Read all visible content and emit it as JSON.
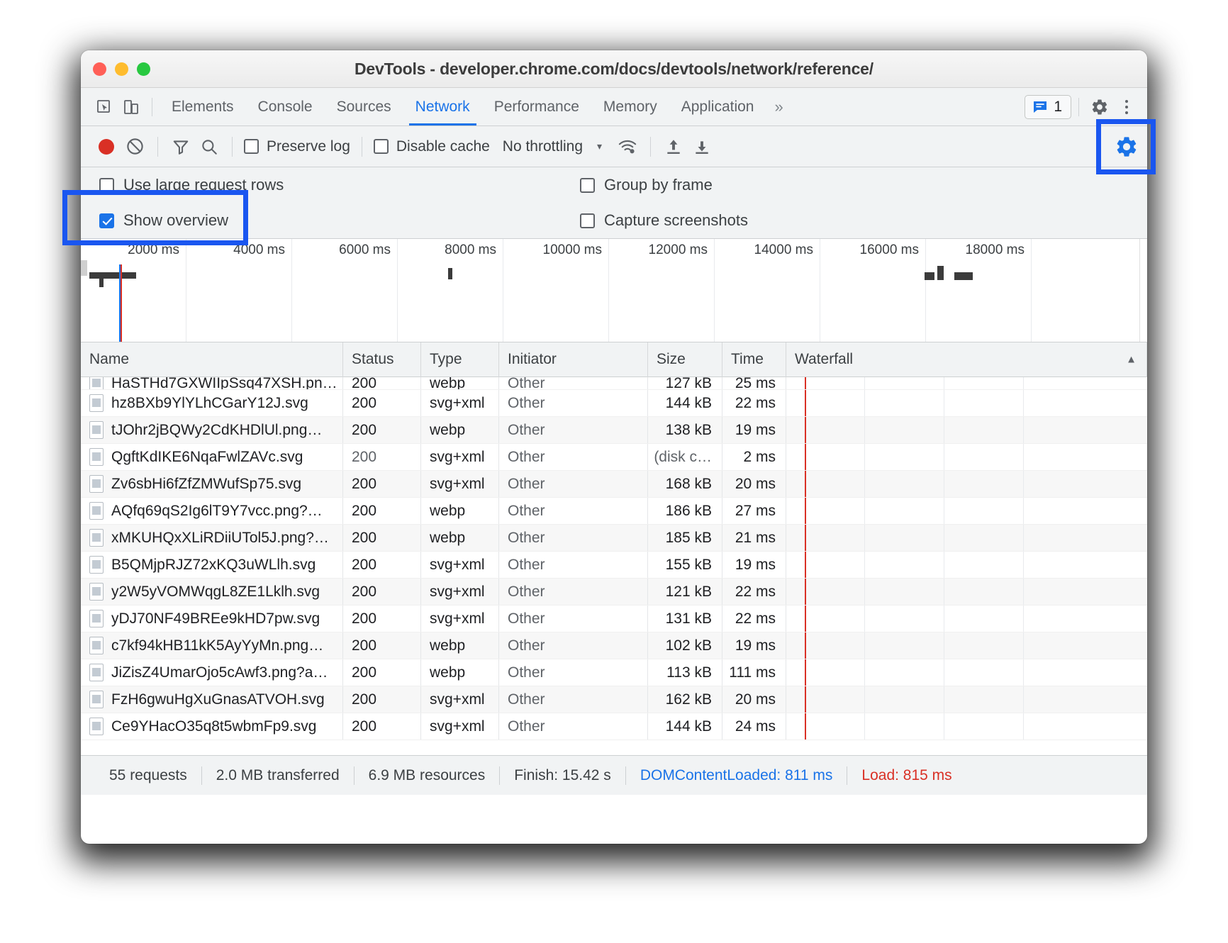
{
  "window": {
    "title": "DevTools - developer.chrome.com/docs/devtools/network/reference/",
    "traffic": {
      "close": "close-button",
      "minimize": "minimize-button",
      "zoom": "zoom-button"
    }
  },
  "tabstrip": {
    "inspect_icon": "inspect-element-icon",
    "device_icon": "device-toolbar-icon",
    "tabs": [
      {
        "label": "Elements",
        "active": false
      },
      {
        "label": "Console",
        "active": false
      },
      {
        "label": "Sources",
        "active": false
      },
      {
        "label": "Network",
        "active": true
      },
      {
        "label": "Performance",
        "active": false
      },
      {
        "label": "Memory",
        "active": false
      },
      {
        "label": "Application",
        "active": false
      }
    ],
    "more_tabs_label": "»",
    "issues_count": "1",
    "issues_icon": "issues-message-icon",
    "settings_icon": "settings-gear-icon",
    "menu_icon": "more-options-icon"
  },
  "toolbar": {
    "record_icon": "record-button-icon",
    "clear_icon": "clear-network-log-icon",
    "filter_icon": "filter-icon",
    "search_icon": "search-icon",
    "preserve_log_label": "Preserve log",
    "preserve_log_checked": false,
    "disable_cache_label": "Disable cache",
    "disable_cache_checked": false,
    "throttling_value": "No throttling",
    "throttling_caret": "▾",
    "network_conditions_icon": "network-conditions-wifi-icon",
    "import_icon": "import-har-icon",
    "export_icon": "export-har-icon",
    "settings_gear_icon": "network-settings-gear-icon"
  },
  "settings_pane": {
    "use_large_rows_label": "Use large request rows",
    "use_large_rows_checked": false,
    "group_by_frame_label": "Group by frame",
    "group_by_frame_checked": false,
    "show_overview_label": "Show overview",
    "show_overview_checked": true,
    "capture_screenshots_label": "Capture screenshots",
    "capture_screenshots_checked": false
  },
  "overview": {
    "ticks": [
      "2000 ms",
      "4000 ms",
      "6000 ms",
      "8000 ms",
      "10000 ms",
      "12000 ms",
      "14000 ms",
      "16000 ms",
      "18000 ms"
    ]
  },
  "table": {
    "columns": [
      "Name",
      "Status",
      "Type",
      "Initiator",
      "Size",
      "Time",
      "Waterfall"
    ],
    "sort_indicator": "▲",
    "clipped_row": {
      "name": "HaSTHd7GXWIIpSsq47XSH.png...",
      "status": "200",
      "type": "webp",
      "initiator": "Other",
      "size": "127 kB",
      "time": "25 ms"
    },
    "rows": [
      {
        "name": "hz8BXb9YlYLhCGarY12J.svg",
        "status": "200",
        "type": "svg+xml",
        "initiator": "Other",
        "size": "144 kB",
        "time": "22 ms"
      },
      {
        "name": "tJOhr2jBQWy2CdKHDlUl.png…",
        "status": "200",
        "type": "webp",
        "initiator": "Other",
        "size": "138 kB",
        "time": "19 ms"
      },
      {
        "name": "QgftKdIKE6NqaFwlZAVc.svg",
        "status": "200",
        "type": "svg+xml",
        "initiator": "Other",
        "size": "(disk c…",
        "time": "2 ms"
      },
      {
        "name": "Zv6sbHi6fZfZMWufSp75.svg",
        "status": "200",
        "type": "svg+xml",
        "initiator": "Other",
        "size": "168 kB",
        "time": "20 ms"
      },
      {
        "name": "AQfq69qS2Ig6lT9Y7vcc.png?…",
        "status": "200",
        "type": "webp",
        "initiator": "Other",
        "size": "186 kB",
        "time": "27 ms"
      },
      {
        "name": "xMKUHQxXLiRDiiUTol5J.png?…",
        "status": "200",
        "type": "webp",
        "initiator": "Other",
        "size": "185 kB",
        "time": "21 ms"
      },
      {
        "name": "B5QMjpRJZ72xKQ3uWLlh.svg",
        "status": "200",
        "type": "svg+xml",
        "initiator": "Other",
        "size": "155 kB",
        "time": "19 ms"
      },
      {
        "name": "y2W5yVOMWqgL8ZE1Lklh.svg",
        "status": "200",
        "type": "svg+xml",
        "initiator": "Other",
        "size": "121 kB",
        "time": "22 ms"
      },
      {
        "name": "yDJ70NF49BREe9kHD7pw.svg",
        "status": "200",
        "type": "svg+xml",
        "initiator": "Other",
        "size": "131 kB",
        "time": "22 ms"
      },
      {
        "name": "c7kf94kHB11kK5AyYyMn.png…",
        "status": "200",
        "type": "webp",
        "initiator": "Other",
        "size": "102 kB",
        "time": "19 ms"
      },
      {
        "name": "JiZisZ4UmarOjo5cAwf3.png?a…",
        "status": "200",
        "type": "webp",
        "initiator": "Other",
        "size": "113 kB",
        "time": "111 ms"
      },
      {
        "name": "FzH6gwuHgXuGnasATVOH.svg",
        "status": "200",
        "type": "svg+xml",
        "initiator": "Other",
        "size": "162 kB",
        "time": "20 ms"
      },
      {
        "name": "Ce9YHacO35q8t5wbmFp9.svg",
        "status": "200",
        "type": "svg+xml",
        "initiator": "Other",
        "size": "144 kB",
        "time": "24 ms"
      }
    ]
  },
  "statusbar": {
    "requests": "55 requests",
    "transferred": "2.0 MB transferred",
    "resources": "6.9 MB resources",
    "finish": "Finish: 15.42 s",
    "dom_content_loaded": "DOMContentLoaded: 811 ms",
    "load": "Load: 815 ms"
  },
  "annotations": {
    "show_overview_box": "highlight-show-overview",
    "gear_box": "highlight-network-settings-gear",
    "color": "#1a56f0"
  }
}
